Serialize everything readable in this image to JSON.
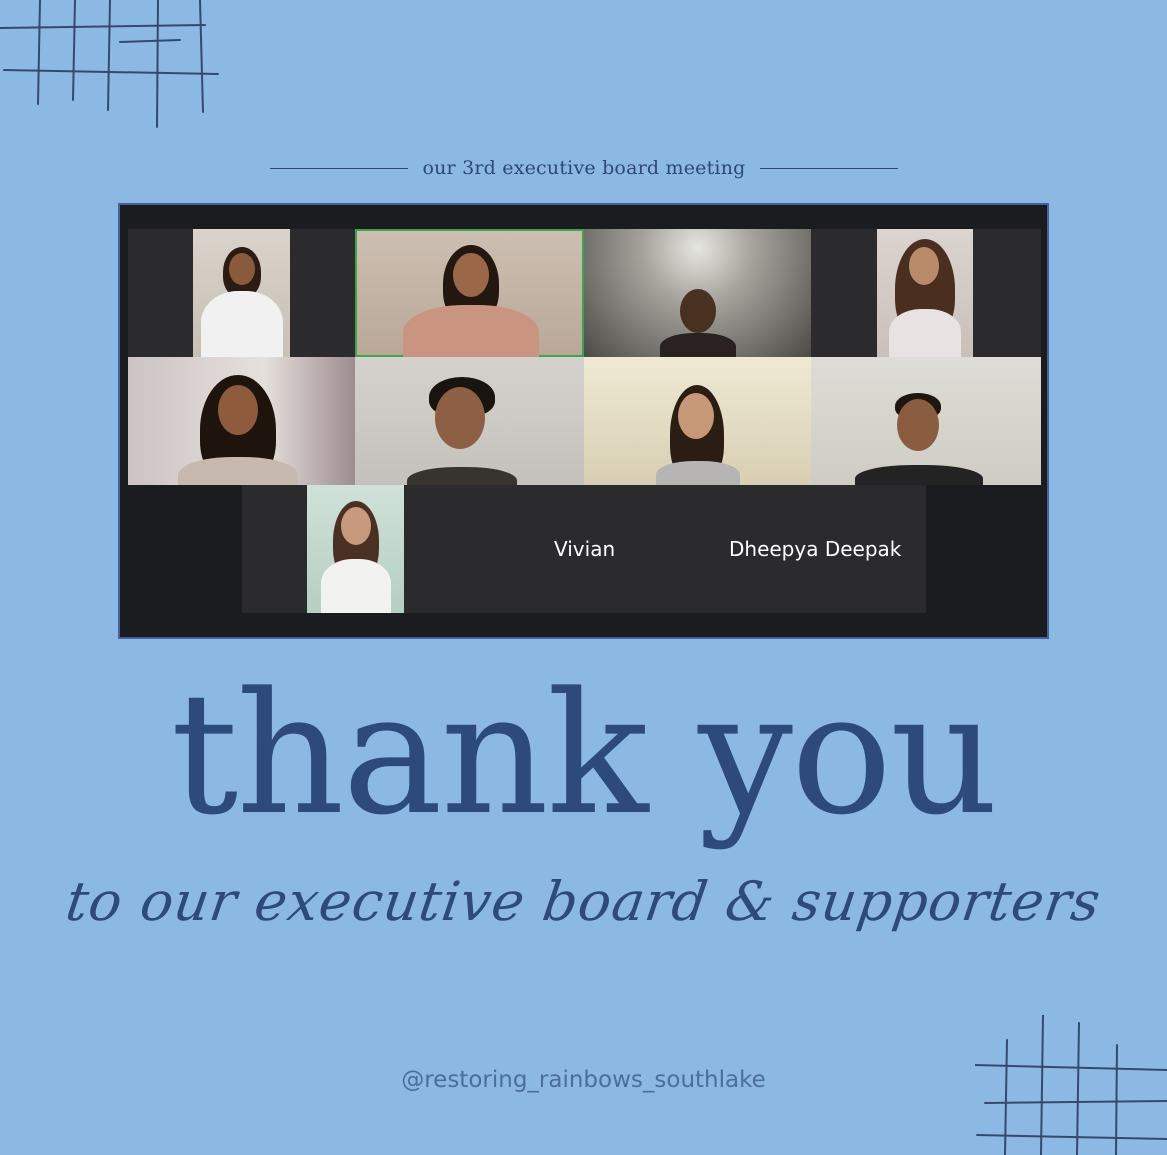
{
  "header": {
    "subtitle": "our 3rd executive board meeting"
  },
  "meeting": {
    "participants": [
      {
        "name": "Vivian"
      },
      {
        "name": "Dheepya Deepak"
      }
    ]
  },
  "headline": "thank you",
  "script_line": "to our executive board & supporters",
  "social_handle": "@restoring_rainbows_southlake",
  "colors": {
    "background": "#8cb8e4",
    "accent": "#2e4a7c",
    "speaker_border": "#3fa34d"
  }
}
